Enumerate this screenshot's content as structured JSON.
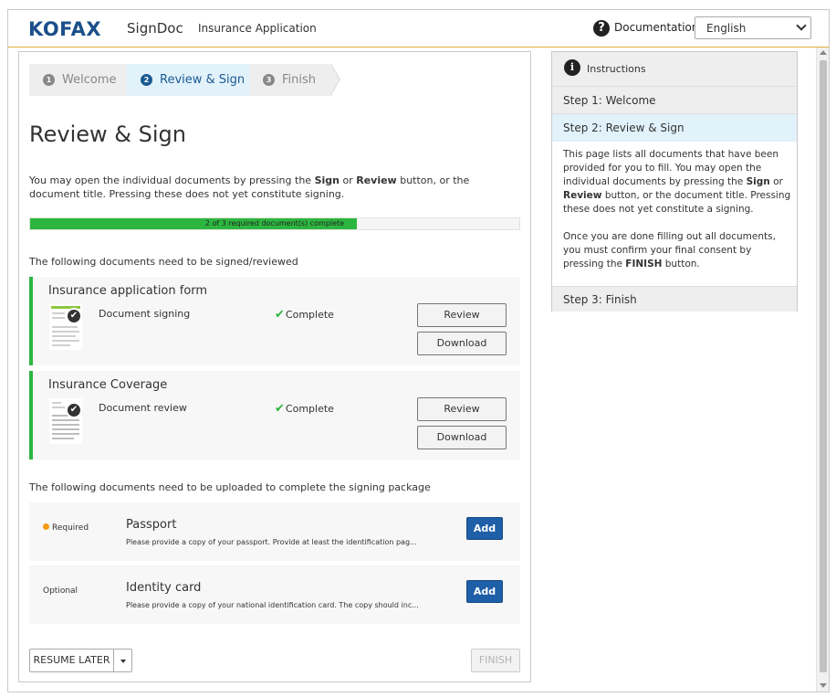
{
  "header": {
    "logo": "KOFAX",
    "product": "SignDoc",
    "app_title": "Insurance Application",
    "documentation": "Documentation",
    "language": "English"
  },
  "wizard": {
    "steps": [
      {
        "num": "1",
        "label": "Welcome"
      },
      {
        "num": "2",
        "label": "Review & Sign"
      },
      {
        "num": "3",
        "label": "Finish"
      }
    ],
    "active_step": 2
  },
  "main": {
    "title": "Review & Sign",
    "intro_1": "You may open the individual documents by pressing the ",
    "intro_sign": "Sign",
    "intro_2": " or ",
    "intro_review": "Review",
    "intro_3": " button, or the document title. Pressing these does not yet constitute signing.",
    "progress_text": "2 of 3 required document(s) complete",
    "progress_fraction": 0.667,
    "docs_section_label": "The following documents need to be signed/reviewed",
    "documents": [
      {
        "title": "Insurance application form",
        "type": "Document signing",
        "status": "Complete",
        "review_label": "Review",
        "download_label": "Download"
      },
      {
        "title": "Insurance Coverage",
        "type": "Document review",
        "status": "Complete",
        "review_label": "Review",
        "download_label": "Download"
      }
    ],
    "uploads_section_label": "The following documents need to be uploaded to complete the signing package",
    "uploads": [
      {
        "requirement": "Required",
        "title": "Passport",
        "description": "Please provide a copy of your passport. Provide at least the identification pag...",
        "add_label": "Add"
      },
      {
        "requirement": "Optional",
        "title": "Identity card",
        "description": "Please provide a copy of your national identification card. The copy should inc...",
        "add_label": "Add"
      }
    ],
    "resume_label": "RESUME LATER",
    "finish_label": "FINISH"
  },
  "instructions": {
    "title": "Instructions",
    "step1": "Step 1: Welcome",
    "step2": "Step 2: Review & Sign",
    "step3": "Step 3: Finish",
    "p1_a": "This page lists all documents that have been provided for you to fill. You may open the individual documents by pressing the ",
    "p1_sign": "Sign",
    "p1_b": " or ",
    "p1_review": "Review",
    "p1_c": " button, or the document title. Pressing these does not yet constitute a signing.",
    "p2_a": "Once you are done filling out all documents, you must confirm your final consent by pressing the ",
    "p2_finish": "FINISH",
    "p2_b": " button."
  },
  "colors": {
    "brand": "#1b4f8a",
    "accent_line": "#e1b13a",
    "success": "#2db63f",
    "primary_button": "#1f5fa8",
    "active_step_bg": "#e2f2fb"
  }
}
